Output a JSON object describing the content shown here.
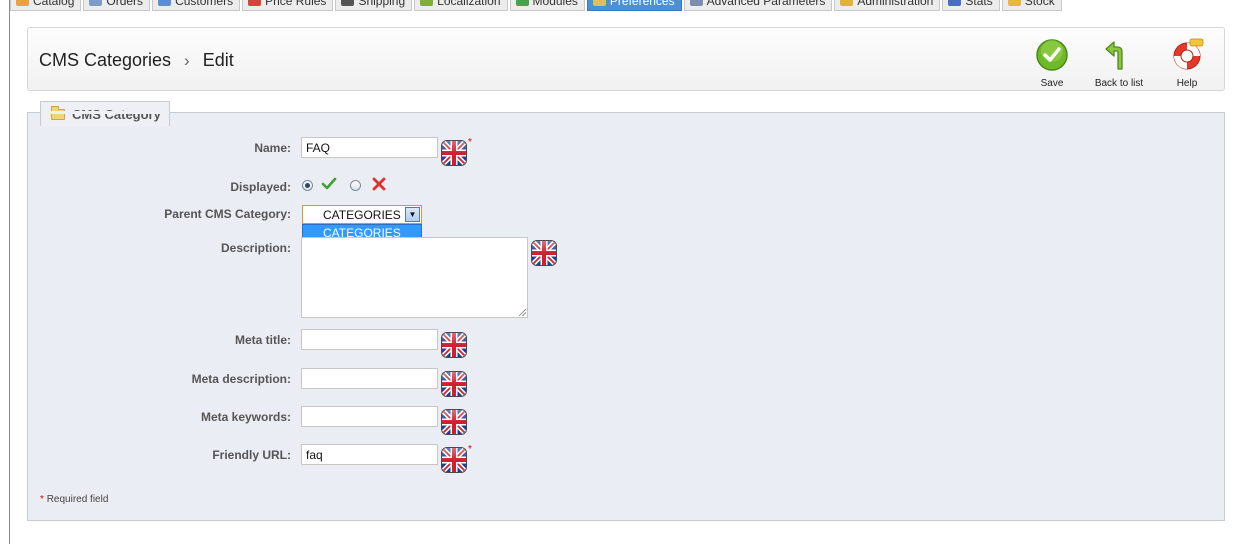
{
  "tabs": [
    {
      "label": "Catalog",
      "icon": "catalog-icon",
      "color": "#e8a33a",
      "active": false
    },
    {
      "label": "Orders",
      "icon": "orders-icon",
      "color": "#7a9cc6",
      "active": false
    },
    {
      "label": "Customers",
      "icon": "customers-icon",
      "color": "#5b8fd0",
      "active": false
    },
    {
      "label": "Price Rules",
      "icon": "price-rules-icon",
      "color": "#d0463a",
      "active": false
    },
    {
      "label": "Shipping",
      "icon": "shipping-icon",
      "color": "#555555",
      "active": false
    },
    {
      "label": "Localization",
      "icon": "localization-icon",
      "color": "#7fae3d",
      "active": false
    },
    {
      "label": "Modules",
      "icon": "modules-icon",
      "color": "#4aa04a",
      "active": false
    },
    {
      "label": "Preferences",
      "icon": "preferences-icon",
      "color": "#e0c05a",
      "active": true
    },
    {
      "label": "Advanced Parameters",
      "icon": "advanced-parameters-icon",
      "color": "#7a8fb0",
      "active": false
    },
    {
      "label": "Administration",
      "icon": "administration-icon",
      "color": "#e0b040",
      "active": false
    },
    {
      "label": "Stats",
      "icon": "stats-icon",
      "color": "#4a6fc0",
      "active": false
    },
    {
      "label": "Stock",
      "icon": "stock-icon",
      "color": "#e8b83a",
      "active": false
    }
  ],
  "breadcrumb": {
    "section": "CMS Categories",
    "separator": "›",
    "page": "Edit"
  },
  "toolbar": {
    "save_label": "Save",
    "back_label": "Back to list",
    "help_label": "Help"
  },
  "form": {
    "legend": "CMS Category",
    "name_label": "Name:",
    "name_value": "FAQ",
    "displayed_label": "Displayed:",
    "displayed": true,
    "parent_label": "Parent CMS Category:",
    "parent_value": "CATEGORIES",
    "parent_options": [
      "CATEGORIES"
    ],
    "description_label": "Description:",
    "meta_title_label": "Meta title:",
    "meta_title_value": "",
    "meta_description_label": "Meta description:",
    "meta_description_value": "",
    "meta_keywords_label": "Meta keywords:",
    "meta_keywords_value": "",
    "friendly_url_label": "Friendly URL:",
    "friendly_url_value": "faq",
    "required_mark": "*",
    "required_note": "Required field"
  },
  "colors": {
    "accent": "#3399ff",
    "active_tab": "#4a90d6",
    "panel": "#ebedf4",
    "required": "#dd0000"
  }
}
